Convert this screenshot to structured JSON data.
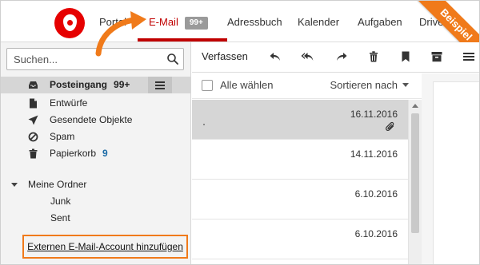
{
  "nav": {
    "items": [
      {
        "label": "Portal"
      },
      {
        "label": "E-Mail",
        "badge": "99+"
      },
      {
        "label": "Adressbuch"
      },
      {
        "label": "Kalender"
      },
      {
        "label": "Aufgaben"
      },
      {
        "label": "Drive"
      }
    ],
    "active_color": "#c00000"
  },
  "ribbon": {
    "label": "Beispiel",
    "color": "#f07a1a"
  },
  "brand": {
    "color": "#e60000"
  },
  "sidebar": {
    "search_placeholder": "Suchen...",
    "folders": [
      {
        "label": "Posteingang",
        "count": "99+",
        "icon": "inbox-icon",
        "selected": true
      },
      {
        "label": "Entwürfe",
        "icon": "file-icon"
      },
      {
        "label": "Gesendete Objekte",
        "icon": "send-icon"
      },
      {
        "label": "Spam",
        "icon": "blocked-icon"
      },
      {
        "label": "Papierkorb",
        "count": "9",
        "icon": "trash-icon"
      }
    ],
    "my_folders_label": "Meine Ordner",
    "sub_folders": [
      "Junk",
      "Sent"
    ],
    "add_account_link": "Externen E-Mail-Account hinzufügen"
  },
  "toolbar": {
    "compose_label": "Verfassen",
    "icons": [
      "reply-icon",
      "reply-all-icon",
      "forward-icon",
      "delete-icon",
      "flag-icon",
      "archive-icon",
      "more-icon"
    ]
  },
  "list": {
    "select_all_label": "Alle wählen",
    "sort_label": "Sortieren nach",
    "mails": [
      {
        "date": "16.11.2016",
        "attachment": true,
        "selected": true
      },
      {
        "date": "14.11.2016",
        "attachment": false,
        "selected": false
      },
      {
        "date": "6.10.2016",
        "attachment": false,
        "selected": false
      },
      {
        "date": "6.10.2016",
        "attachment": false,
        "selected": false
      }
    ]
  }
}
